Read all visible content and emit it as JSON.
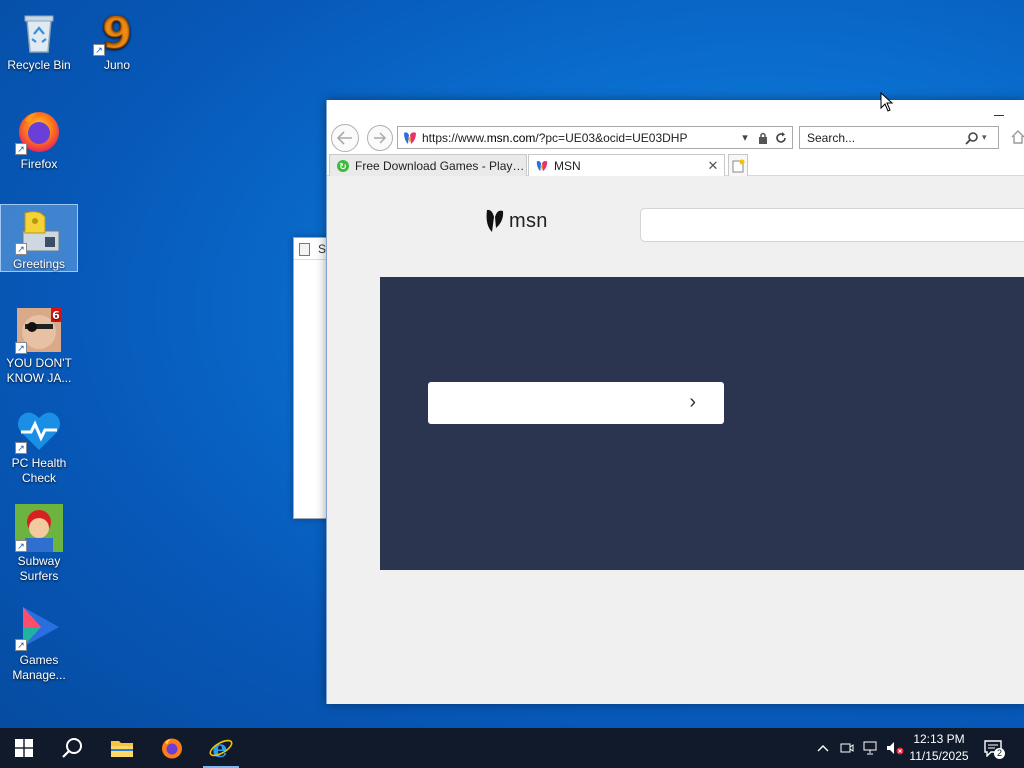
{
  "desktop": {
    "icons": [
      {
        "label": "Recycle Bin"
      },
      {
        "label": "Juno"
      },
      {
        "label": "Firefox"
      },
      {
        "label": "Greetings"
      },
      {
        "label": "YOU DON'T KNOW JA..."
      },
      {
        "label": "PC Health Check"
      },
      {
        "label": "Subway Surfers"
      },
      {
        "label": "Games Manage..."
      }
    ],
    "juno_glyph": "9",
    "you_dont_know_badge": "6"
  },
  "background_window": {
    "title_initial": "S"
  },
  "browser": {
    "address": {
      "url_prefix": "https://www.",
      "url_host": "msn.com",
      "url_path": "/?pc=UE03&ocid=UE03DHP"
    },
    "search": {
      "placeholder": "Search..."
    },
    "tabs": [
      {
        "label": "Free Download Games - Play T..."
      },
      {
        "label": "MSN"
      }
    ],
    "page": {
      "logo_text": "msn"
    }
  },
  "taskbar": {
    "clock_time": "12:13 PM",
    "clock_date": "11/15/2025",
    "notification_count": "2"
  },
  "colors": {
    "hero_bg": "#2b3550",
    "taskbar_bg": "#101a2a",
    "desktop_blue": "#0a6fd0"
  }
}
